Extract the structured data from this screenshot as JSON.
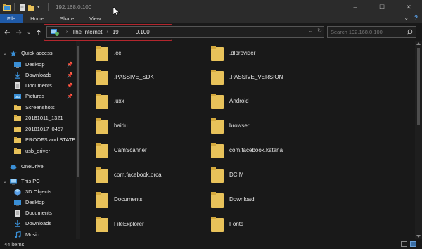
{
  "window": {
    "title": "192.168.0.100",
    "controls": [
      "–",
      "☐",
      "✕"
    ]
  },
  "ribbon": {
    "tabs": [
      "File",
      "Home",
      "Share",
      "View"
    ],
    "collapse": "⌄",
    "help": "?"
  },
  "address": {
    "crumbs": [
      "The Internet",
      "19   0.100"
    ],
    "separator": "›",
    "dropdown": "⌄",
    "refresh": "↻"
  },
  "search": {
    "placeholder": "Search 192.168.0.100"
  },
  "sidebar": {
    "quick_access": "Quick access",
    "items": [
      {
        "label": "Desktop",
        "pinned": true,
        "icon": "desktop-icon"
      },
      {
        "label": "Downloads",
        "pinned": true,
        "icon": "download-icon"
      },
      {
        "label": "Documents",
        "pinned": true,
        "icon": "documents-icon"
      },
      {
        "label": "Pictures",
        "pinned": true,
        "icon": "pictures-icon"
      },
      {
        "label": "Screenshots",
        "pinned": false,
        "icon": "folder-icon"
      },
      {
        "label": "20181011_1321",
        "pinned": false,
        "icon": "folder-icon"
      },
      {
        "label": "20181017_0457",
        "pinned": false,
        "icon": "folder-icon"
      },
      {
        "label": "PROOFS and STATEM",
        "pinned": false,
        "icon": "folder-icon"
      },
      {
        "label": "usb_driver",
        "pinned": false,
        "icon": "folder-icon"
      }
    ],
    "onedrive": "OneDrive",
    "this_pc": "This PC",
    "pc_items": [
      {
        "label": "3D Objects",
        "icon": "3d-objects-icon"
      },
      {
        "label": "Desktop",
        "icon": "desktop-icon"
      },
      {
        "label": "Documents",
        "icon": "documents-icon"
      },
      {
        "label": "Downloads",
        "icon": "download-icon"
      },
      {
        "label": "Music",
        "icon": "music-icon"
      }
    ]
  },
  "folders": {
    "left": [
      ".cc",
      ".PASSIVE_SDK",
      ".uxx",
      "baidu",
      "CamScanner",
      "com.facebook.orca",
      "Documents",
      "FileExplorer"
    ],
    "right": [
      ".dlprovider",
      ".PASSIVE_VERSION",
      "Android",
      "browser",
      "com.facebook.katana",
      "DCIM",
      "Download",
      "Fonts"
    ]
  },
  "status": {
    "count": "44 items"
  },
  "colors": {
    "accent": "#1f5aa8",
    "highlight_box": "#b3262d",
    "folder": "#e8c25a"
  }
}
